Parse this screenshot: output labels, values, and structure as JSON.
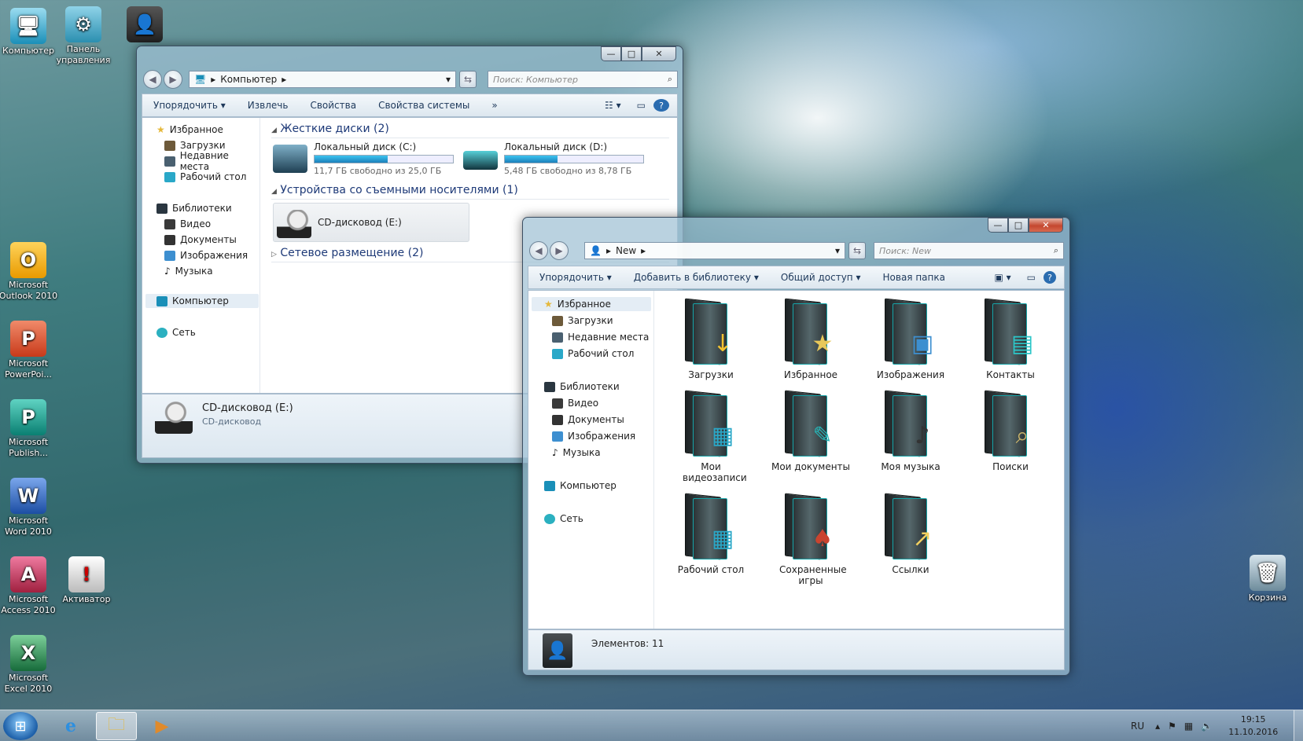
{
  "desktop": {
    "icons": [
      {
        "label": "Компьютер",
        "icon": "computer-icon",
        "color": "#1aa0c8"
      },
      {
        "label": "Панель управления",
        "icon": "control-panel-icon",
        "color": "#2b8fb0"
      },
      {
        "label": "",
        "icon": "user-icon",
        "color": "#333"
      },
      {
        "label": "Microsoft Outlook 2010",
        "icon": "outlook-icon",
        "color": "#e8a000"
      },
      {
        "label": "Microsoft PowerPoi...",
        "icon": "powerpoint-icon",
        "color": "#d24726"
      },
      {
        "label": "Microsoft Publish...",
        "icon": "publisher-icon",
        "color": "#0f9b8e"
      },
      {
        "label": "Microsoft Word 2010",
        "icon": "word-icon",
        "color": "#2b5fb4"
      },
      {
        "label": "Microsoft Access 2010",
        "icon": "access-icon",
        "color": "#b7305a"
      },
      {
        "label": "Активатор",
        "icon": "activator-icon",
        "color": "#666"
      },
      {
        "label": "Microsoft Excel 2010",
        "icon": "excel-icon",
        "color": "#217346"
      },
      {
        "label": "Корзина",
        "icon": "recycle-bin-icon",
        "color": "#4a6a7a"
      }
    ]
  },
  "win1": {
    "address": "Компьютер",
    "search_placeholder": "Поиск: Компьютер",
    "toolbar": [
      "Упорядочить",
      "Извлечь",
      "Свойства",
      "Свойства системы"
    ],
    "toolbar_more": "»",
    "organize_arrow": "▾",
    "nav": [
      "Избранное",
      "Загрузки",
      "Недавние места",
      "Рабочий стол",
      "Библиотеки",
      "Видео",
      "Документы",
      "Изображения",
      "Музыка",
      "Компьютер",
      "Сеть"
    ],
    "groups": {
      "hdd": "Жесткие диски (2)",
      "removable": "Устройства со съемными носителями (1)",
      "network": "Сетевое размещение (2)"
    },
    "drives": [
      {
        "name": "Локальный диск (C:)",
        "free": "11,7 ГБ свободно из 25,0 ГБ",
        "used_fraction": 0.53
      },
      {
        "name": "Локальный диск (D:)",
        "free": "5,48 ГБ свободно из 8,78 ГБ",
        "used_fraction": 0.38
      }
    ],
    "cd": "CD-дисковод (E:)",
    "status": {
      "title": "CD-дисковод (E:)",
      "subtitle": "CD-дисковод"
    }
  },
  "win2": {
    "address": "New",
    "search_placeholder": "Поиск: New",
    "toolbar": [
      "Упорядочить",
      "Добавить в библиотеку",
      "Общий доступ",
      "Новая папка"
    ],
    "nav": [
      "Избранное",
      "Загрузки",
      "Недавние места",
      "Рабочий стол",
      "Библиотеки",
      "Видео",
      "Документы",
      "Изображения",
      "Музыка",
      "Компьютер",
      "Сеть"
    ],
    "folders": [
      {
        "label": "Загрузки",
        "overlay": "↓",
        "color": "#f2c230"
      },
      {
        "label": "Избранное",
        "overlay": "★",
        "color": "#e8c85a"
      },
      {
        "label": "Изображения",
        "overlay": "▣",
        "color": "#3d8fd0"
      },
      {
        "label": "Контакты",
        "overlay": "▤",
        "color": "#2cc6c8"
      },
      {
        "label": "Мои видеозаписи",
        "overlay": "▦",
        "color": "#2aa8c8"
      },
      {
        "label": "Мои документы",
        "overlay": "✎",
        "color": "#28b3b5"
      },
      {
        "label": "Моя музыка",
        "overlay": "♪",
        "color": "#333"
      },
      {
        "label": "Поиски",
        "overlay": "⌕",
        "color": "#c9b36a"
      },
      {
        "label": "Рабочий стол",
        "overlay": "▦",
        "color": "#2aa8c8"
      },
      {
        "label": "Сохраненные игры",
        "overlay": "♠",
        "color": "#c9442f"
      },
      {
        "label": "Ссылки",
        "overlay": "↗",
        "color": "#f2d060"
      }
    ],
    "status": "Элементов: 11"
  },
  "window_controls": {
    "minimize": "—",
    "maximize": "□",
    "close": "✕"
  },
  "taskbar": {
    "lang": "RU",
    "time": "19:15",
    "date": "11.10.2016"
  }
}
